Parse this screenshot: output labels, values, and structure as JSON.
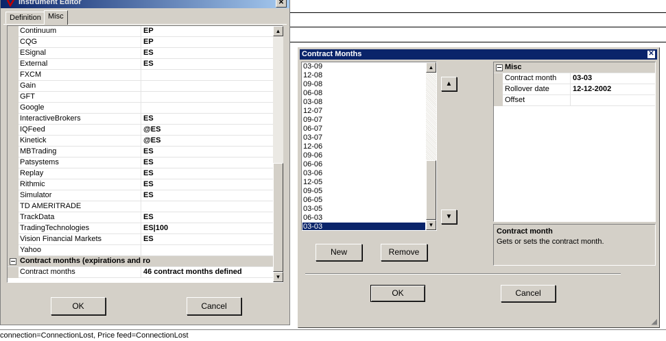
{
  "background": {
    "status_text": "connection=ConnectionLost, Price  feed=ConnectionLost"
  },
  "instrument_editor": {
    "title": "Instrument Editor",
    "close_glyph": "✕",
    "tabs": [
      "Definition",
      "Misc"
    ],
    "active_tab": "Misc",
    "rows": [
      {
        "name": "Continuum",
        "value": "EP"
      },
      {
        "name": "CQG",
        "value": "EP"
      },
      {
        "name": "ESignal",
        "value": "ES"
      },
      {
        "name": "External",
        "value": "ES"
      },
      {
        "name": "FXCM",
        "value": ""
      },
      {
        "name": "Gain",
        "value": ""
      },
      {
        "name": "GFT",
        "value": ""
      },
      {
        "name": "Google",
        "value": ""
      },
      {
        "name": "InteractiveBrokers",
        "value": "ES"
      },
      {
        "name": "IQFeed",
        "value": "@ES"
      },
      {
        "name": "Kinetick",
        "value": "@ES"
      },
      {
        "name": "MBTrading",
        "value": "ES"
      },
      {
        "name": "Patsystems",
        "value": "ES"
      },
      {
        "name": "Replay",
        "value": "ES"
      },
      {
        "name": "Rithmic",
        "value": "ES"
      },
      {
        "name": "Simulator",
        "value": "ES"
      },
      {
        "name": "TD AMERITRADE",
        "value": ""
      },
      {
        "name": "TrackData",
        "value": "ES"
      },
      {
        "name": "TradingTechnologies",
        "value": "ES|100"
      },
      {
        "name": "Vision Financial Markets",
        "value": "ES"
      },
      {
        "name": "Yahoo",
        "value": ""
      }
    ],
    "category": {
      "toggle": "⊟",
      "label": "Contract months (expirations and ro"
    },
    "contract_months_row": {
      "name": "Contract months",
      "value": "46 contract months defined"
    },
    "ok_label": "OK",
    "cancel_label": "Cancel"
  },
  "contract_months_dialog": {
    "title": "Contract Months",
    "close_glyph": "✕",
    "months": [
      "03-09",
      "12-08",
      "09-08",
      "06-08",
      "03-08",
      "12-07",
      "09-07",
      "06-07",
      "03-07",
      "12-06",
      "09-06",
      "06-06",
      "03-06",
      "12-05",
      "09-05",
      "06-05",
      "03-05",
      "06-03",
      "03-03"
    ],
    "selected_month": "03-03",
    "move_up_glyph": "▲",
    "move_down_glyph": "▼",
    "new_label": "New",
    "remove_label": "Remove",
    "category": {
      "toggle": "⊟",
      "label": "Misc"
    },
    "properties": [
      {
        "name": "Contract month",
        "value": "03-03"
      },
      {
        "name": "Rollover date",
        "value": "12-12-2002"
      },
      {
        "name": "Offset",
        "value": ""
      }
    ],
    "description_title": "Contract month",
    "description_text": "Gets or sets the contract month.",
    "ok_label": "OK",
    "cancel_label": "Cancel",
    "grip_glyph": "◢"
  }
}
